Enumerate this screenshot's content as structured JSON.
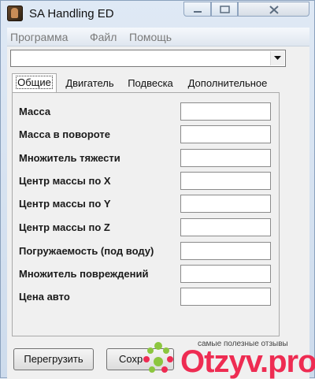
{
  "window": {
    "title": "SA Handling ED",
    "icon": "car-driver-icon"
  },
  "menu": {
    "items": [
      {
        "label": "Программа"
      },
      {
        "label": "Файл"
      },
      {
        "label": "Помощь"
      }
    ]
  },
  "vehicle_select": {
    "value": ""
  },
  "tabs": [
    {
      "label": "Общие",
      "active": true
    },
    {
      "label": "Двигатель",
      "active": false
    },
    {
      "label": "Подвеска",
      "active": false
    },
    {
      "label": "Дополнительное",
      "active": false
    }
  ],
  "fields": [
    {
      "label": "Масса",
      "value": ""
    },
    {
      "label": "Масса в повороте",
      "value": ""
    },
    {
      "label": "Множитель тяжести",
      "value": ""
    },
    {
      "label": "Центр массы по X",
      "value": ""
    },
    {
      "label": "Центр массы по Y",
      "value": ""
    },
    {
      "label": "Центр массы по Z",
      "value": ""
    },
    {
      "label": "Погружаемость (под воду)",
      "value": ""
    },
    {
      "label": "Множитель повреждений",
      "value": ""
    },
    {
      "label": "Цена авто",
      "value": ""
    }
  ],
  "buttons": {
    "reload": "Перегрузить",
    "save": "Сохр"
  },
  "watermark": {
    "caption": "самые полезные отзывы",
    "logo": "Otzyv.pro",
    "colors": {
      "red": "#ee2c52",
      "green": "#8cc63f"
    }
  }
}
